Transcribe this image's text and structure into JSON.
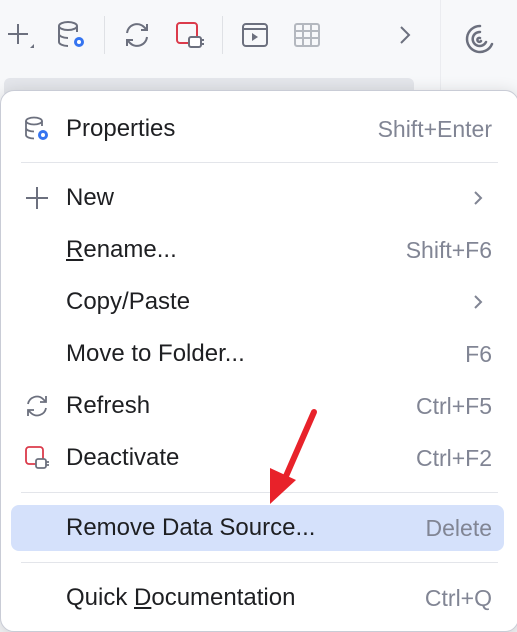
{
  "toolbar": {
    "icons": [
      "add-icon",
      "datasource-settings-icon",
      "refresh-icon",
      "deactivate-icon",
      "console-icon",
      "table-icon",
      "chevron-right-icon"
    ]
  },
  "side": {
    "icon": "ai-assistant-icon"
  },
  "menu": {
    "items": [
      {
        "label": "Properties",
        "shortcut": "Shift+Enter",
        "icon": "datasource-properties-icon"
      },
      {
        "label": "New",
        "shortcut": "",
        "icon": "plus-icon",
        "submenu": true
      },
      {
        "label_prefix": "",
        "label_mnemonic": "R",
        "label_rest": "ename...",
        "shortcut": "Shift+F6"
      },
      {
        "label": "Copy/Paste",
        "shortcut": "",
        "submenu": true
      },
      {
        "label": "Move to Folder...",
        "shortcut": "F6"
      },
      {
        "label": "Refresh",
        "shortcut": "Ctrl+F5",
        "icon": "refresh-icon"
      },
      {
        "label": "Deactivate",
        "shortcut": "Ctrl+F2",
        "icon": "deactivate-icon"
      },
      {
        "label": "Remove Data Source...",
        "shortcut": "Delete",
        "selected": true
      },
      {
        "label_prefix": "Quick ",
        "label_mnemonic": "D",
        "label_rest": "ocumentation",
        "shortcut": "Ctrl+Q"
      }
    ]
  },
  "colors": {
    "selection": "#d5e1fb",
    "annotation_arrow": "#e8222a",
    "accent": "#3574f0",
    "deactivate": "#db3b4b"
  }
}
